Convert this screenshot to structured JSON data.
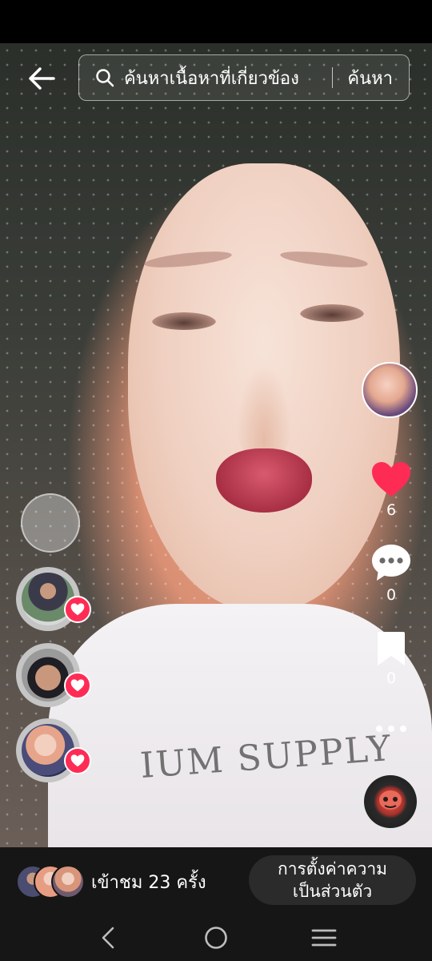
{
  "search": {
    "placeholder": "ค้นหาเนื้อหาที่เกี่ยวข้อง",
    "button_label": "ค้นหา"
  },
  "actions": {
    "likes": "6",
    "comments": "0",
    "saves": "0"
  },
  "video": {
    "shirt_text": "IUM SUPPLY"
  },
  "footer": {
    "views_text": "เข้าชม 23 ครั้ง",
    "privacy_button_line1": "การตั้งค่าความ",
    "privacy_button_line2": "เป็นส่วนตัว"
  },
  "icons": {
    "back": "arrow-left-icon",
    "search": "search-icon",
    "like": "heart-icon",
    "comment": "comment-icon",
    "save": "bookmark-icon",
    "more": "more-icon",
    "nav_back": "chevron-left-icon",
    "nav_home": "circle-home-icon",
    "nav_recent": "menu-lines-icon"
  },
  "colors": {
    "like_red": "#fe2c55",
    "background": "#000000",
    "bottom_bar": "#161616"
  }
}
